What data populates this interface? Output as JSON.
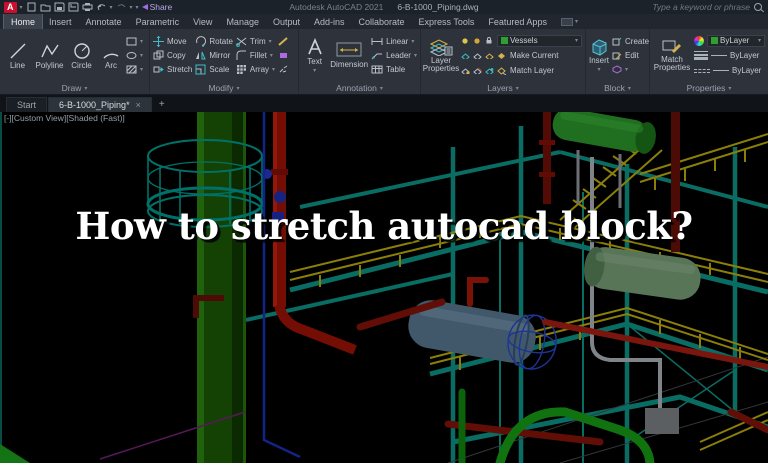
{
  "ui": {
    "caret": "▾",
    "close": "×",
    "plus": "+"
  },
  "titlebar": {
    "logo": "A",
    "share_label": "Share",
    "app_title": "Autodesk AutoCAD 2021",
    "doc_title": "6-B-1000_Piping.dwg",
    "search_placeholder": "Type a keyword or phrase"
  },
  "tabs": [
    {
      "label": "Home",
      "active": true
    },
    {
      "label": "Insert"
    },
    {
      "label": "Annotate"
    },
    {
      "label": "Parametric"
    },
    {
      "label": "View"
    },
    {
      "label": "Manage"
    },
    {
      "label": "Output"
    },
    {
      "label": "Add-ins"
    },
    {
      "label": "Collaborate"
    },
    {
      "label": "Express Tools"
    },
    {
      "label": "Featured Apps"
    }
  ],
  "ribbon": {
    "draw": {
      "label": "Draw",
      "tools": [
        "Line",
        "Polyline",
        "Circle",
        "Arc"
      ]
    },
    "modify": {
      "label": "Modify",
      "cols": [
        [
          "Move",
          "Copy",
          "Stretch"
        ],
        [
          "Rotate",
          "Mirror",
          "Scale"
        ],
        [
          "Trim",
          "Fillet",
          "Array"
        ]
      ]
    },
    "annotation": {
      "label": "Annotation",
      "text_tool": "Text",
      "dimension_tool": "Dimension",
      "small_tools": [
        "Linear",
        "Leader",
        "Table"
      ]
    },
    "layers": {
      "label": "Layers",
      "big_tool": "Layer Properties",
      "dropdown_value": "Vessels",
      "make_current": "Make Current",
      "match_layer": "Match Layer"
    },
    "block": {
      "label": "Block",
      "big_tool": "Insert",
      "create": "Create",
      "edit": "Edit"
    },
    "properties": {
      "label": "Properties",
      "big_tool": "Match Properties",
      "color_value": "ByLayer",
      "lineweight_value": "ByLayer",
      "linetype_value": "ByLayer"
    }
  },
  "file_tabs": {
    "start": "Start",
    "document": "6-B-1000_Piping*"
  },
  "viewport": {
    "controls": "[-][Custom View][Shaded (Fast)]"
  },
  "hero": {
    "title": "How to stretch autocad block?"
  },
  "colors": {
    "accent_red": "#c8102e",
    "ribbon_bg": "#2e333b",
    "share_purple": "#a06be0",
    "layer_swatch_green": "#2fa02f",
    "column_green": "#1e5f08",
    "structure_teal": "#0d9c8e",
    "handrail_yellow": "#c7b70c",
    "pipe_red": "#a61507",
    "vessel_green": "#2f9e2f",
    "vessel_sage": "#7fa87f",
    "exchanger_blue": "#5d7f99",
    "pipe_bright_green": "#17a517",
    "line_magenta": "#7d2580"
  }
}
